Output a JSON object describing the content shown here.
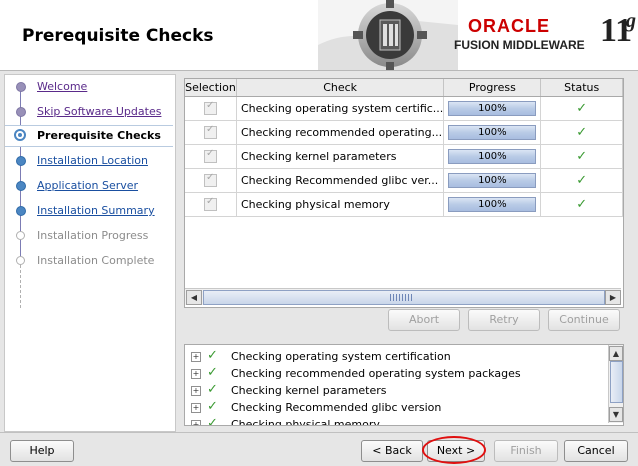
{
  "header": {
    "title": "Prerequisite Checks",
    "brand": "ORACLE",
    "product": "FUSION MIDDLEWARE",
    "version": "11",
    "version_sup": "g"
  },
  "nav": {
    "items": [
      {
        "label": "Welcome",
        "state": "done"
      },
      {
        "label": "Skip Software Updates",
        "state": "done"
      },
      {
        "label": "Prerequisite Checks",
        "state": "current"
      },
      {
        "label": "Installation Location",
        "state": "next"
      },
      {
        "label": "Application Server",
        "state": "next"
      },
      {
        "label": "Installation Summary",
        "state": "next"
      },
      {
        "label": "Installation Progress",
        "state": "future"
      },
      {
        "label": "Installation Complete",
        "state": "future"
      }
    ]
  },
  "table": {
    "headers": [
      "Selection",
      "Check",
      "Progress",
      "Status"
    ],
    "rows": [
      {
        "check": "Checking operating system certific...",
        "progress": "100%"
      },
      {
        "check": "Checking recommended operating...",
        "progress": "100%"
      },
      {
        "check": "Checking kernel parameters",
        "progress": "100%"
      },
      {
        "check": "Checking Recommended glibc ver...",
        "progress": "100%"
      },
      {
        "check": "Checking physical memory",
        "progress": "100%"
      }
    ]
  },
  "actions": {
    "abort": "Abort",
    "retry": "Retry",
    "continue": "Continue"
  },
  "log": {
    "rows": [
      "Checking operating system certification",
      "Checking recommended operating system packages",
      "Checking kernel parameters",
      "Checking Recommended glibc version",
      "Checking physical memory"
    ]
  },
  "footer": {
    "help": "Help",
    "back": "< Back",
    "next": "Next >",
    "finish": "Finish",
    "cancel": "Cancel"
  },
  "colors": {
    "accent": "#4b86c2",
    "success": "#3a9a32",
    "highlight": "#e01010"
  }
}
